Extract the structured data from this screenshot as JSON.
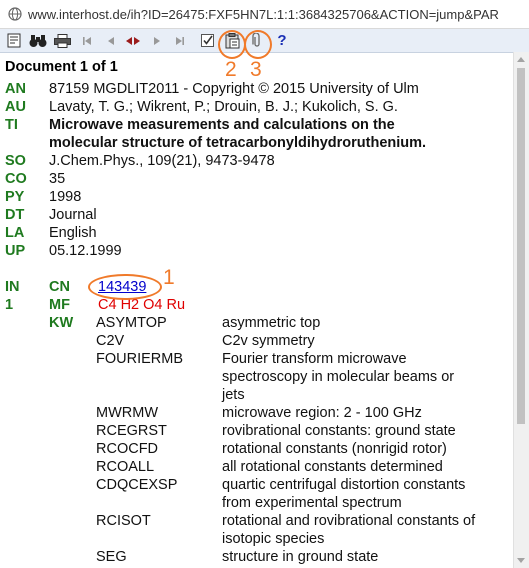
{
  "address_bar": {
    "url": "www.interhost.de/ih?ID=26475:FXF5HN7L:1:1:3684325706&ACTION=jump&PAR"
  },
  "toolbar": {
    "buttons": [
      "document-icon",
      "binoculars-icon",
      "print-icon",
      "first-icon",
      "prev-icon",
      "jump-icon",
      "next-icon",
      "last-icon",
      "checkbox-icon",
      "clipboard-icon",
      "attach-icon",
      "help-icon"
    ],
    "help_label": "?"
  },
  "document": {
    "header": "Document 1 of 1",
    "fields": [
      {
        "code": "AN",
        "value": "87159 MGDLIT2011 - Copyright © 2015 University of Ulm"
      },
      {
        "code": "AU",
        "value": "Lavaty, T. G.; Wikrent, P.; Drouin, B. J.; Kukolich, S. G."
      },
      {
        "code": "TI",
        "value": "Microwave measurements and calculations on the",
        "value2": "molecular structure of tetracarbonyldihydroruthenium."
      },
      {
        "code": "SO",
        "value": "J.Chem.Phys., 109(21), 9473-9478"
      },
      {
        "code": "CO",
        "value": "35"
      },
      {
        "code": "PY",
        "value": "1998"
      },
      {
        "code": "DT",
        "value": "Journal"
      },
      {
        "code": "LA",
        "value": "English"
      },
      {
        "code": "UP",
        "value": "05.12.1999"
      }
    ],
    "index": {
      "in_label": "IN",
      "num": "1",
      "cn_label": "CN",
      "cn_value": "143439",
      "mf_label": "MF",
      "mf_value": "C4 H2 O4 Ru",
      "kw_label": "KW"
    },
    "keywords": [
      {
        "code": "ASYMTOP",
        "desc": [
          "asymmetric top"
        ]
      },
      {
        "code": "C2V",
        "desc": [
          "C2v symmetry"
        ]
      },
      {
        "code": "FOURIERMB",
        "desc": [
          "Fourier transform microwave",
          "spectroscopy in molecular beams or",
          "jets"
        ]
      },
      {
        "code": "MWRMW",
        "desc": [
          "microwave region: 2 - 100 GHz"
        ]
      },
      {
        "code": "RCEGRST",
        "desc": [
          "rovibrational constants: ground state"
        ]
      },
      {
        "code": "RCOCFD",
        "desc": [
          "rotational constants (nonrigid rotor)"
        ]
      },
      {
        "code": "RCOALL",
        "desc": [
          "all rotational constants determined"
        ]
      },
      {
        "code": "CDQCEXSP",
        "desc": [
          "quartic centrifugal distortion constants",
          "from experimental spectrum"
        ]
      },
      {
        "code": "RCISOT",
        "desc": [
          "rotational and rovibrational constants of",
          "isotopic species"
        ]
      },
      {
        "code": "SEG",
        "desc": [
          "structure in ground state"
        ]
      }
    ]
  },
  "annotations": {
    "a1": "1",
    "a2": "2",
    "a3": "3"
  },
  "colors": {
    "field_label": "#1f7a1f",
    "formula": "#e00000",
    "link": "#0000cc",
    "annotation": "#f07a2a",
    "toolbar_bg": "#e8eef7"
  }
}
